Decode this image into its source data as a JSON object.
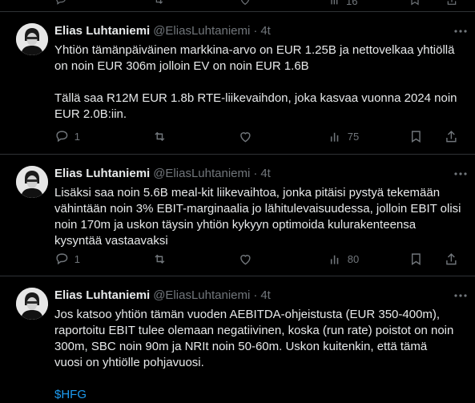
{
  "top_actions": {
    "views_count": "16"
  },
  "tweets": [
    {
      "name": "Elias Luhtaniemi",
      "handle": "@EliasLuhtaniemi",
      "separator": "·",
      "time": "4t",
      "lines": [
        "Yhtiön tämänpäiväinen markkina-arvo on EUR 1.25B ja nettovelkaa yhtiöllä",
        "on noin EUR 306m jolloin EV on noin EUR 1.6B",
        "",
        "Tällä saa R12M EUR 1.8b RTE-liikevaihdon, joka kasvaa vuonna 2024 noin",
        "EUR 2.0B:iin."
      ],
      "replies": "1",
      "views": "75"
    },
    {
      "name": "Elias Luhtaniemi",
      "handle": "@EliasLuhtaniemi",
      "separator": "·",
      "time": "4t",
      "lines": [
        "Lisäksi saa noin 5.6B meal-kit liikevaihtoa, jonka pitäisi pystyä tekemään",
        "vähintään noin 3% EBIT-marginaalia jo lähitulevaisuudessa, jolloin EBIT olisi",
        "noin 170m ja uskon täysin yhtiön kykyyn optimoida kulurakenteensa",
        "kysyntää vastaavaksi"
      ],
      "replies": "1",
      "views": "80"
    },
    {
      "name": "Elias Luhtaniemi",
      "handle": "@EliasLuhtaniemi",
      "separator": "·",
      "time": "4t",
      "lines": [
        "Jos katsoo yhtiön tämän vuoden AEBITDA-ohjeistusta (EUR 350-400m),",
        "raportoitu EBIT tulee olemaan negatiivinen, koska (run rate) poistot on noin",
        "300m, SBC noin 90m ja NRIt noin 50-60m. Uskon kuitenkin, että tämä",
        "vuosi on yhtiölle pohjavuosi.",
        ""
      ],
      "cashtag": "$HFG"
    }
  ],
  "colors": {
    "background": "#000000",
    "text": "#e7e9ea",
    "muted": "#71767b",
    "link": "#1d9bf0",
    "border": "#2f3336"
  }
}
